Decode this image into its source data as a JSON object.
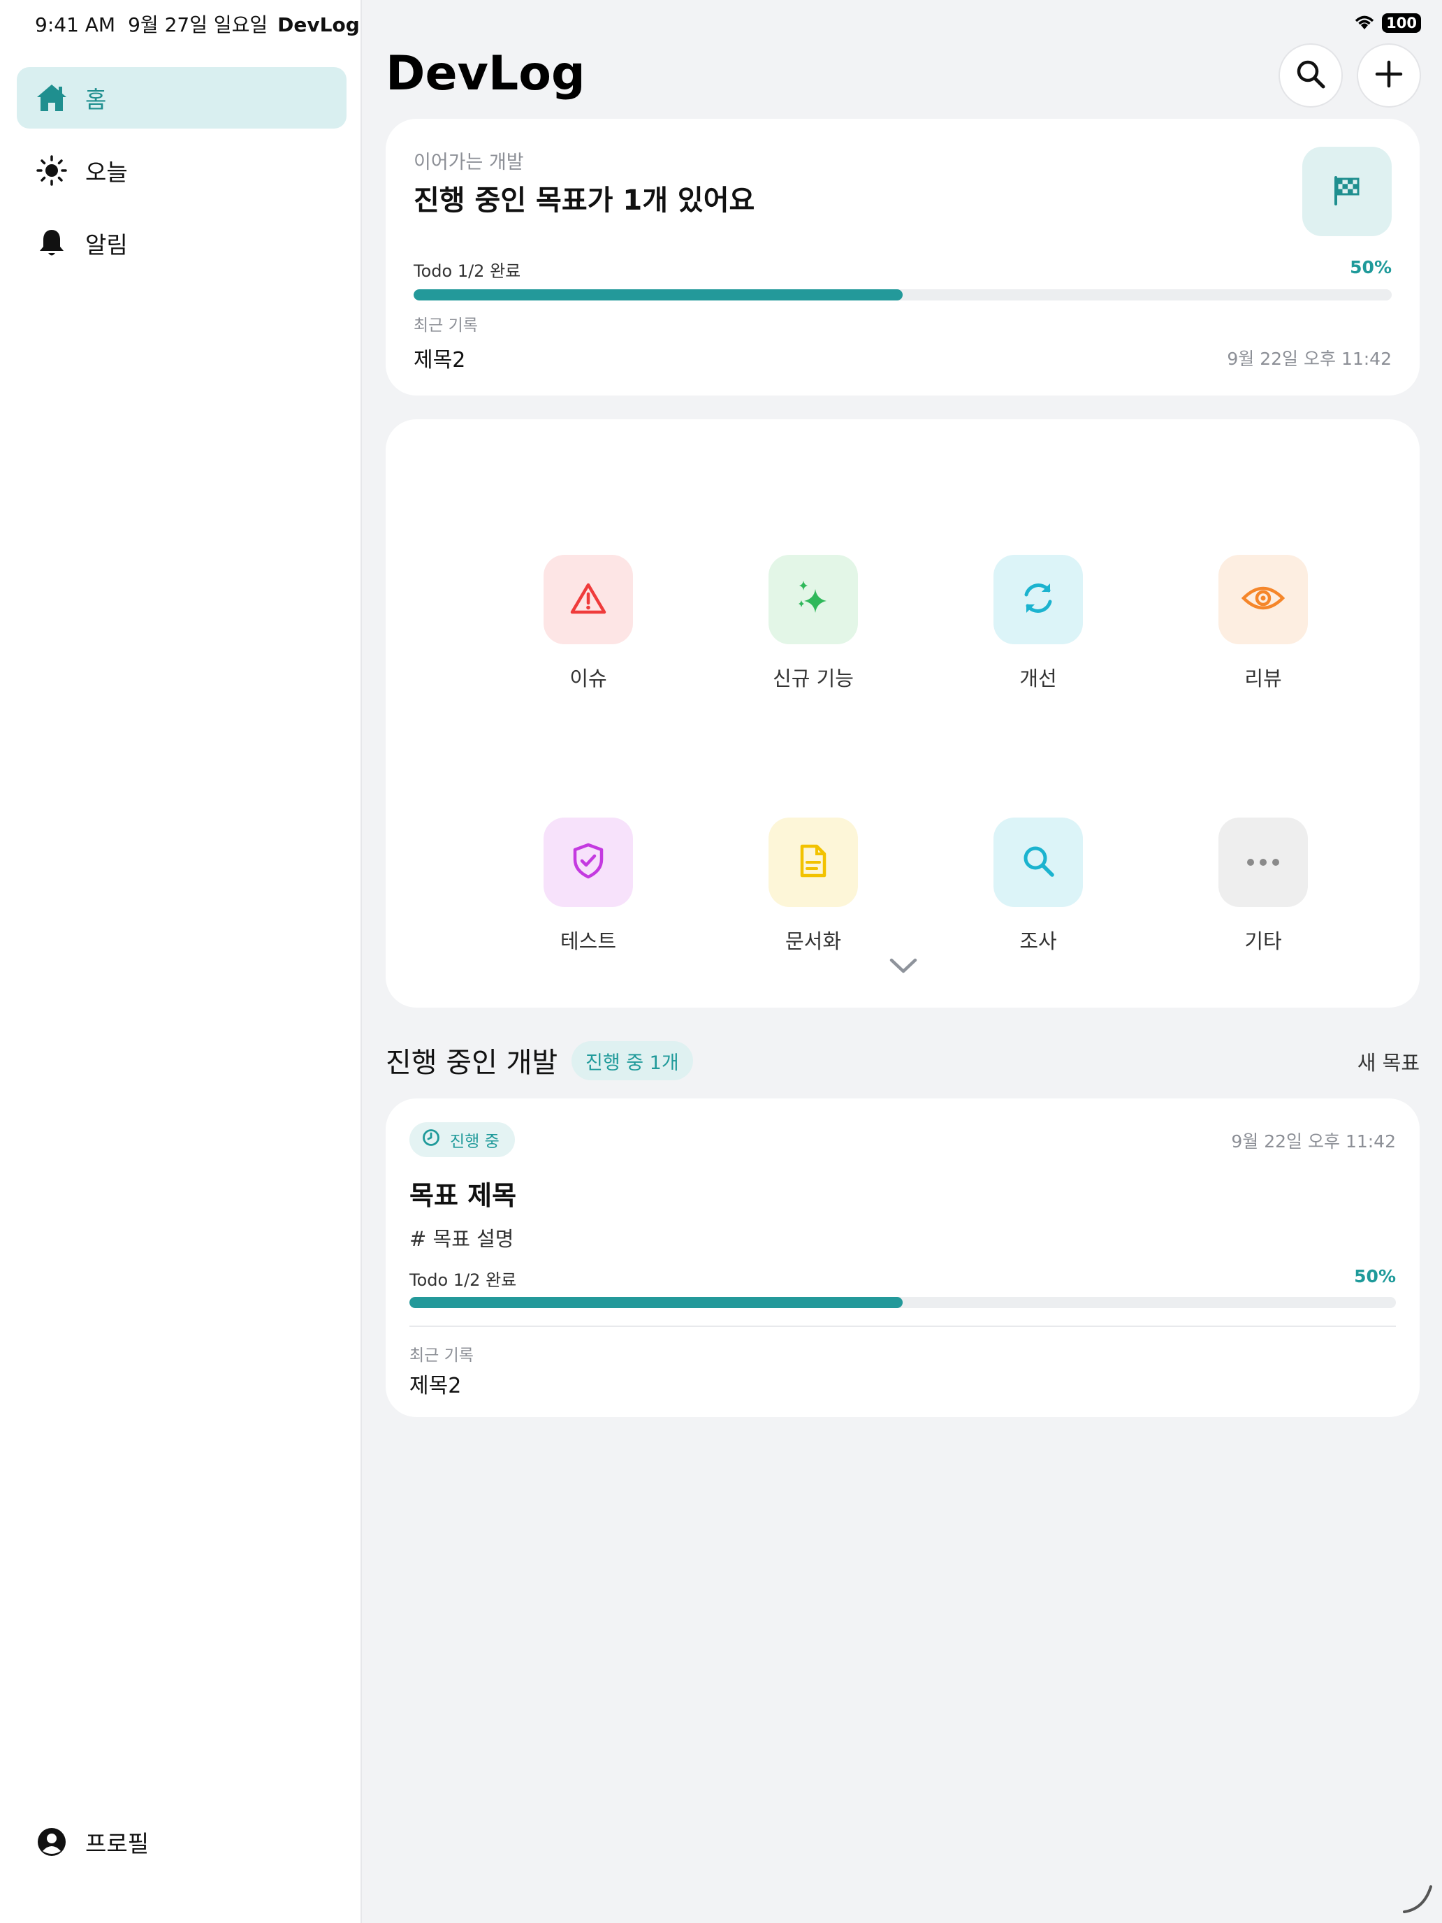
{
  "status_bar": {
    "time": "9:41 AM",
    "date": "9월 27일 일요일",
    "app_name": "DevLog",
    "battery": "100"
  },
  "sidebar": {
    "items": [
      {
        "label": "홈",
        "icon": "house-icon"
      },
      {
        "label": "오늘",
        "icon": "sun-icon"
      },
      {
        "label": "알림",
        "icon": "bell-icon"
      }
    ],
    "profile": {
      "label": "프로필",
      "icon": "person-circle-icon"
    }
  },
  "header": {
    "title": "DevLog",
    "search_icon": "magnifying-glass-icon",
    "add_icon": "plus-icon"
  },
  "continue_card": {
    "subtitle": "이어가는 개발",
    "title": "진행 중인 목표가 1개 있어요",
    "flag_icon": "checkered-flag-icon",
    "todo_label": "Todo 1/2 완료",
    "percent_label": "50%",
    "progress": 0.5,
    "recent_label": "최근 기록",
    "recent_title": "제목2",
    "timestamp": "9월 22일 오후 11:42"
  },
  "categories": [
    {
      "label": "이슈",
      "icon": "warning-triangle-icon",
      "color": "#ef3b3b",
      "bg": "#fde5e5"
    },
    {
      "label": "신규 기능",
      "icon": "sparkles-icon",
      "color": "#2fb85a",
      "bg": "#e3f6e7"
    },
    {
      "label": "개선",
      "icon": "refresh-arrows-icon",
      "color": "#1bb3cf",
      "bg": "#dcf4f8"
    },
    {
      "label": "리뷰",
      "icon": "eye-icon",
      "color": "#f5862a",
      "bg": "#fdeee1"
    },
    {
      "label": "테스트",
      "icon": "shield-check-icon",
      "color": "#c43ae0",
      "bg": "#f7e2fb"
    },
    {
      "label": "문서화",
      "icon": "document-icon",
      "color": "#f2c200",
      "bg": "#fdf6d8"
    },
    {
      "label": "조사",
      "icon": "magnifying-glass-icon",
      "color": "#1bb3cf",
      "bg": "#dcf4f8"
    },
    {
      "label": "기타",
      "icon": "ellipsis-icon",
      "color": "#8a8a8a",
      "bg": "#eeeeee"
    }
  ],
  "expand_icon": "chevron-down-icon",
  "in_progress": {
    "title": "진행 중인 개발",
    "badge": "진행 중 1개",
    "new_goal": "새 목표",
    "goal": {
      "status": "진행 중",
      "status_icon": "clock-icon",
      "timestamp": "9월 22일 오후 11:42",
      "title": "목표 제목",
      "description": "# 목표 설명",
      "todo_label": "Todo 1/2 완료",
      "percent_label": "50%",
      "progress": 0.5,
      "recent_label": "최근 기록",
      "recent_title": "제목2"
    }
  }
}
